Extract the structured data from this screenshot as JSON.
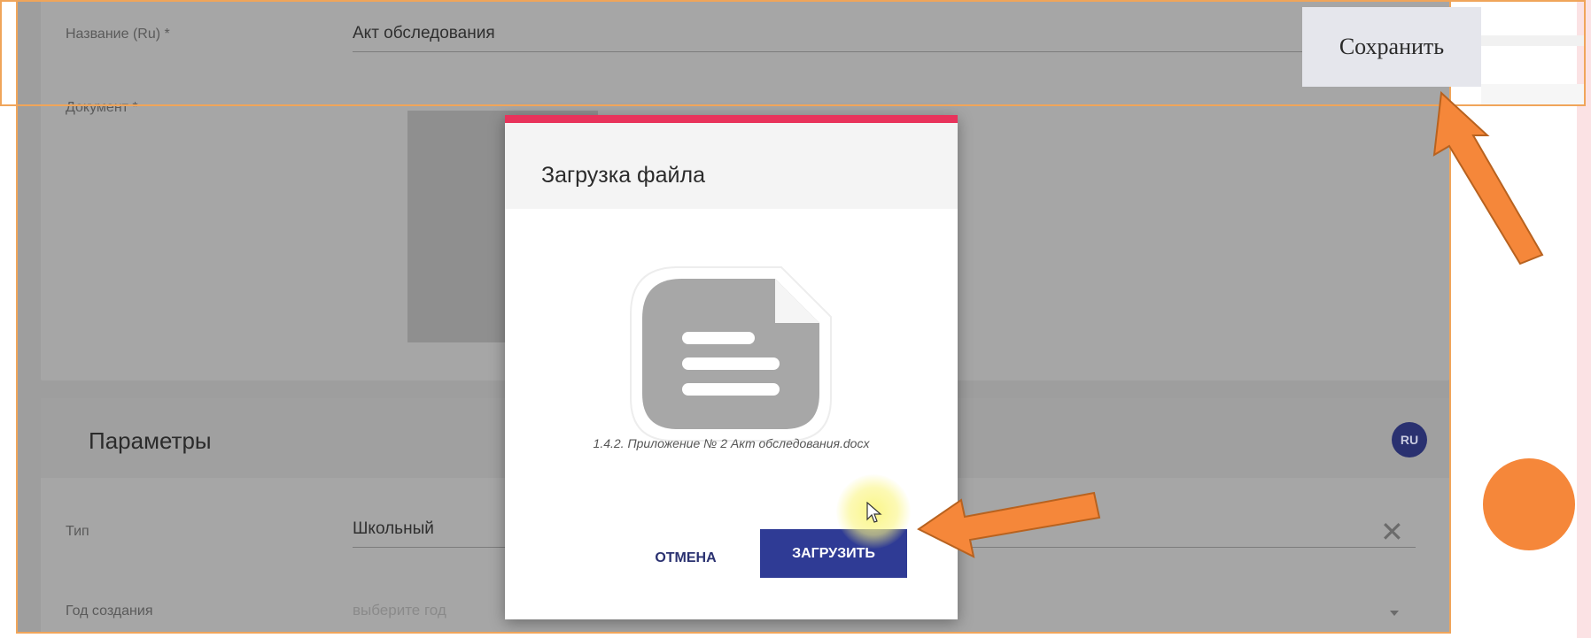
{
  "form": {
    "name_label": "Название (Ru) *",
    "name_value": "Акт обследования",
    "document_label": "Документ *"
  },
  "params": {
    "title": "Параметры",
    "lang_badge": "RU",
    "type_label": "Тип",
    "type_value": "Школьный",
    "year_label": "Год создания",
    "year_placeholder": "выберите год"
  },
  "modal": {
    "title": "Загрузка файла",
    "file_name": "1.4.2. Приложение № 2 Акт обследования.docx",
    "cancel_label": "ОТМЕНА",
    "upload_label": "ЗАГРУЗИТЬ",
    "accent_color": "#e8335b",
    "primary_color": "#2f3b95"
  },
  "callout": {
    "save_label": "Сохранить",
    "arrow_color": "#f5873a"
  }
}
